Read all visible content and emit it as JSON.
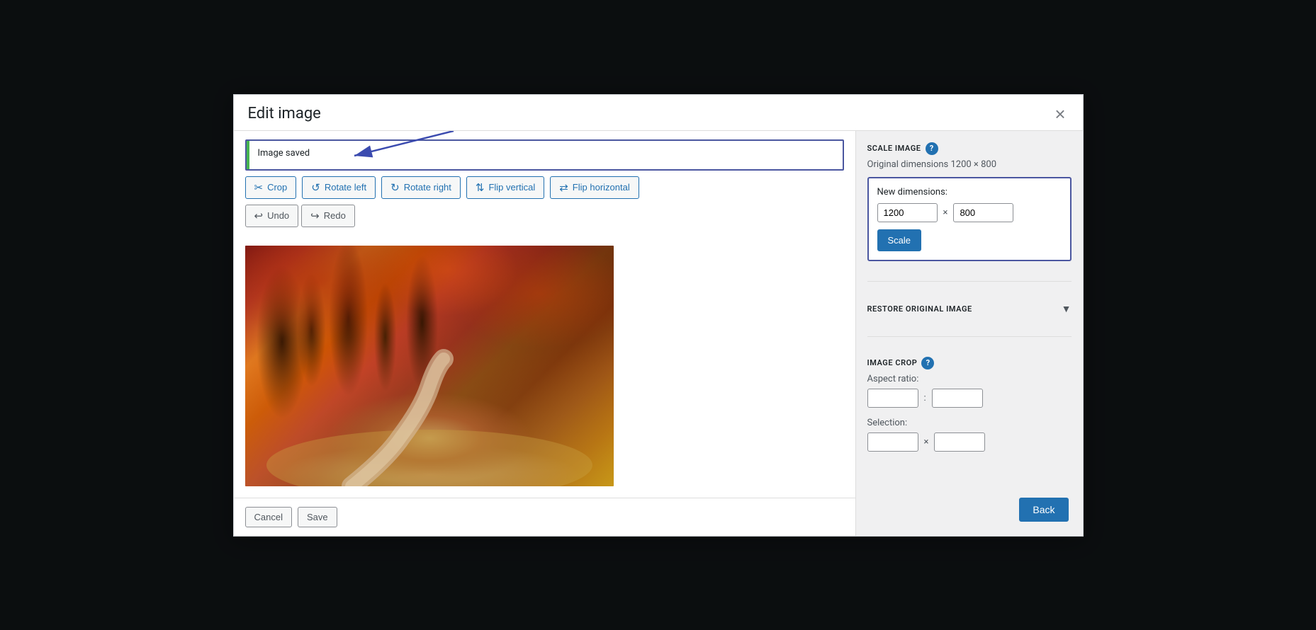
{
  "modal": {
    "title": "Edit image",
    "close_label": "×"
  },
  "notification": {
    "text": "Image saved"
  },
  "toolbar": {
    "crop_label": "Crop",
    "rotate_left_label": "Rotate left",
    "rotate_right_label": "Rotate right",
    "flip_vertical_label": "Flip vertical",
    "flip_horizontal_label": "Flip horizontal",
    "undo_label": "Undo",
    "redo_label": "Redo"
  },
  "footer": {
    "cancel_label": "Cancel",
    "save_label": "Save"
  },
  "sidebar": {
    "scale_image": {
      "title": "SCALE IMAGE",
      "help": "?",
      "original_dims": "Original dimensions 1200 × 800",
      "new_dims_label": "New dimensions:",
      "width_value": "1200",
      "height_value": "800",
      "x_separator": "×",
      "scale_button": "Scale"
    },
    "restore": {
      "title": "RESTORE ORIGINAL IMAGE"
    },
    "image_crop": {
      "title": "IMAGE CROP",
      "help": "?",
      "aspect_ratio_label": "Aspect ratio:",
      "selection_label": "Selection:",
      "ratio_x": "",
      "ratio_y": "",
      "sel_x": "",
      "sel_y": "",
      "colon": ":",
      "x_sep": "×"
    }
  },
  "back_button": {
    "label": "Back"
  }
}
